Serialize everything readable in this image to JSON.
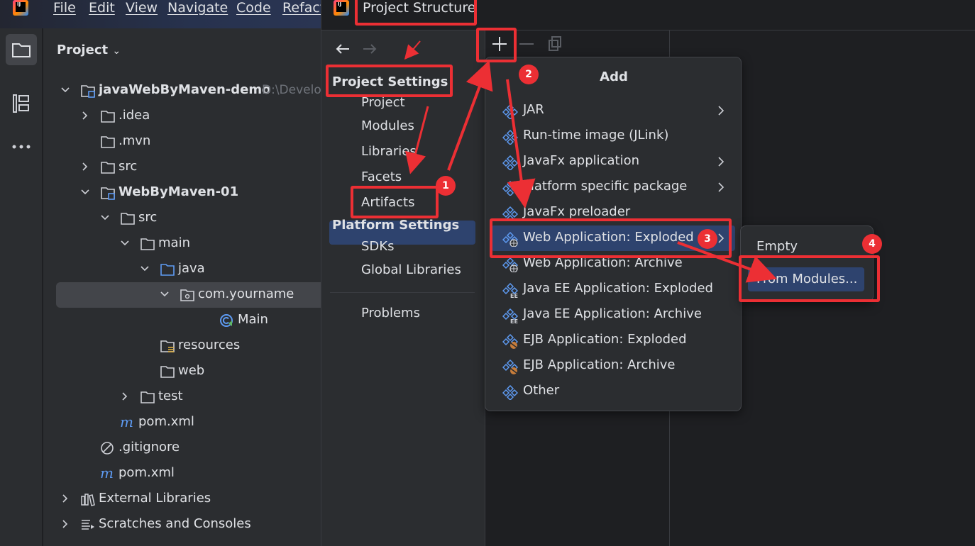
{
  "menubar": {
    "items": [
      "File",
      "Edit",
      "View",
      "Navigate",
      "Code",
      "Refact"
    ]
  },
  "project_panel": {
    "title": "Project",
    "tree": [
      {
        "label": "javaWebByMaven-demo",
        "hint": "D:\\Develo",
        "bold": true,
        "expanded": true,
        "icon": "module-folder-icon"
      },
      {
        "label": ".idea",
        "expanded": false,
        "icon": "folder-icon"
      },
      {
        "label": ".mvn",
        "icon": "folder-icon"
      },
      {
        "label": "src",
        "expanded": false,
        "icon": "folder-icon"
      },
      {
        "label": "WebByMaven-01",
        "bold": true,
        "expanded": true,
        "icon": "module-folder-icon"
      },
      {
        "label": "src",
        "expanded": true,
        "icon": "folder-icon"
      },
      {
        "label": "main",
        "expanded": true,
        "icon": "folder-icon"
      },
      {
        "label": "java",
        "expanded": true,
        "icon": "source-folder-icon"
      },
      {
        "label": "com.yourname",
        "expanded": true,
        "icon": "package-icon",
        "selected": true
      },
      {
        "label": "Main",
        "icon": "java-class-icon"
      },
      {
        "label": "resources",
        "icon": "resources-folder-icon"
      },
      {
        "label": "web",
        "icon": "folder-icon"
      },
      {
        "label": "test",
        "expanded": false,
        "icon": "folder-icon"
      },
      {
        "label": "pom.xml",
        "icon": "maven-icon"
      },
      {
        "label": ".gitignore",
        "icon": "ignore-file-icon"
      },
      {
        "label": "pom.xml",
        "icon": "maven-icon"
      },
      {
        "label": "External Libraries",
        "expanded": false,
        "icon": "library-icon"
      },
      {
        "label": "Scratches and Consoles",
        "expanded": false,
        "icon": "scratches-icon"
      }
    ]
  },
  "dialog": {
    "title": "Project Structure",
    "project_settings_header": "Project Settings",
    "project_settings": [
      "Project",
      "Modules",
      "Libraries",
      "Facets",
      "Artifacts"
    ],
    "selected": "Artifacts",
    "platform_settings_header": "Platform Settings",
    "platform_settings": [
      "SDKs",
      "Global Libraries"
    ],
    "problems": "Problems"
  },
  "add_popup": {
    "title": "Add",
    "items": [
      {
        "label": "JAR",
        "submenu": true,
        "icon": "artifact-icon"
      },
      {
        "label": "Run-time image (JLink)",
        "submenu": false,
        "icon": "artifact-icon"
      },
      {
        "label": "JavaFx application",
        "submenu": true,
        "icon": "artifact-icon"
      },
      {
        "label": "Platform specific package",
        "submenu": true,
        "icon": "artifact-icon"
      },
      {
        "label": "JavaFx preloader",
        "submenu": false,
        "icon": "artifact-icon"
      },
      {
        "label": "Web Application: Exploded",
        "submenu": true,
        "icon": "web-artifact-icon",
        "selected": true
      },
      {
        "label": "Web Application: Archive",
        "submenu": false,
        "icon": "web-artifact-icon"
      },
      {
        "label": "Java EE Application: Exploded",
        "submenu": false,
        "icon": "javaee-artifact-icon"
      },
      {
        "label": "Java EE Application: Archive",
        "submenu": false,
        "icon": "javaee-artifact-icon"
      },
      {
        "label": "EJB Application: Exploded",
        "submenu": false,
        "icon": "ejb-artifact-icon"
      },
      {
        "label": "EJB Application: Archive",
        "submenu": false,
        "icon": "ejb-artifact-icon"
      },
      {
        "label": "Other",
        "submenu": false,
        "icon": "artifact-icon"
      }
    ]
  },
  "sub_popup": {
    "items": [
      "Empty",
      "From Modules..."
    ],
    "selected": "From Modules..."
  },
  "annotations": {
    "badges": [
      "1",
      "2",
      "3",
      "4"
    ],
    "color": "#ec2f34"
  },
  "colors": {
    "selection": "#2e436e",
    "panel_bg": "#2b2d30",
    "editor_bg": "#1e1f22",
    "accent_icon": "#5e9bf3"
  }
}
